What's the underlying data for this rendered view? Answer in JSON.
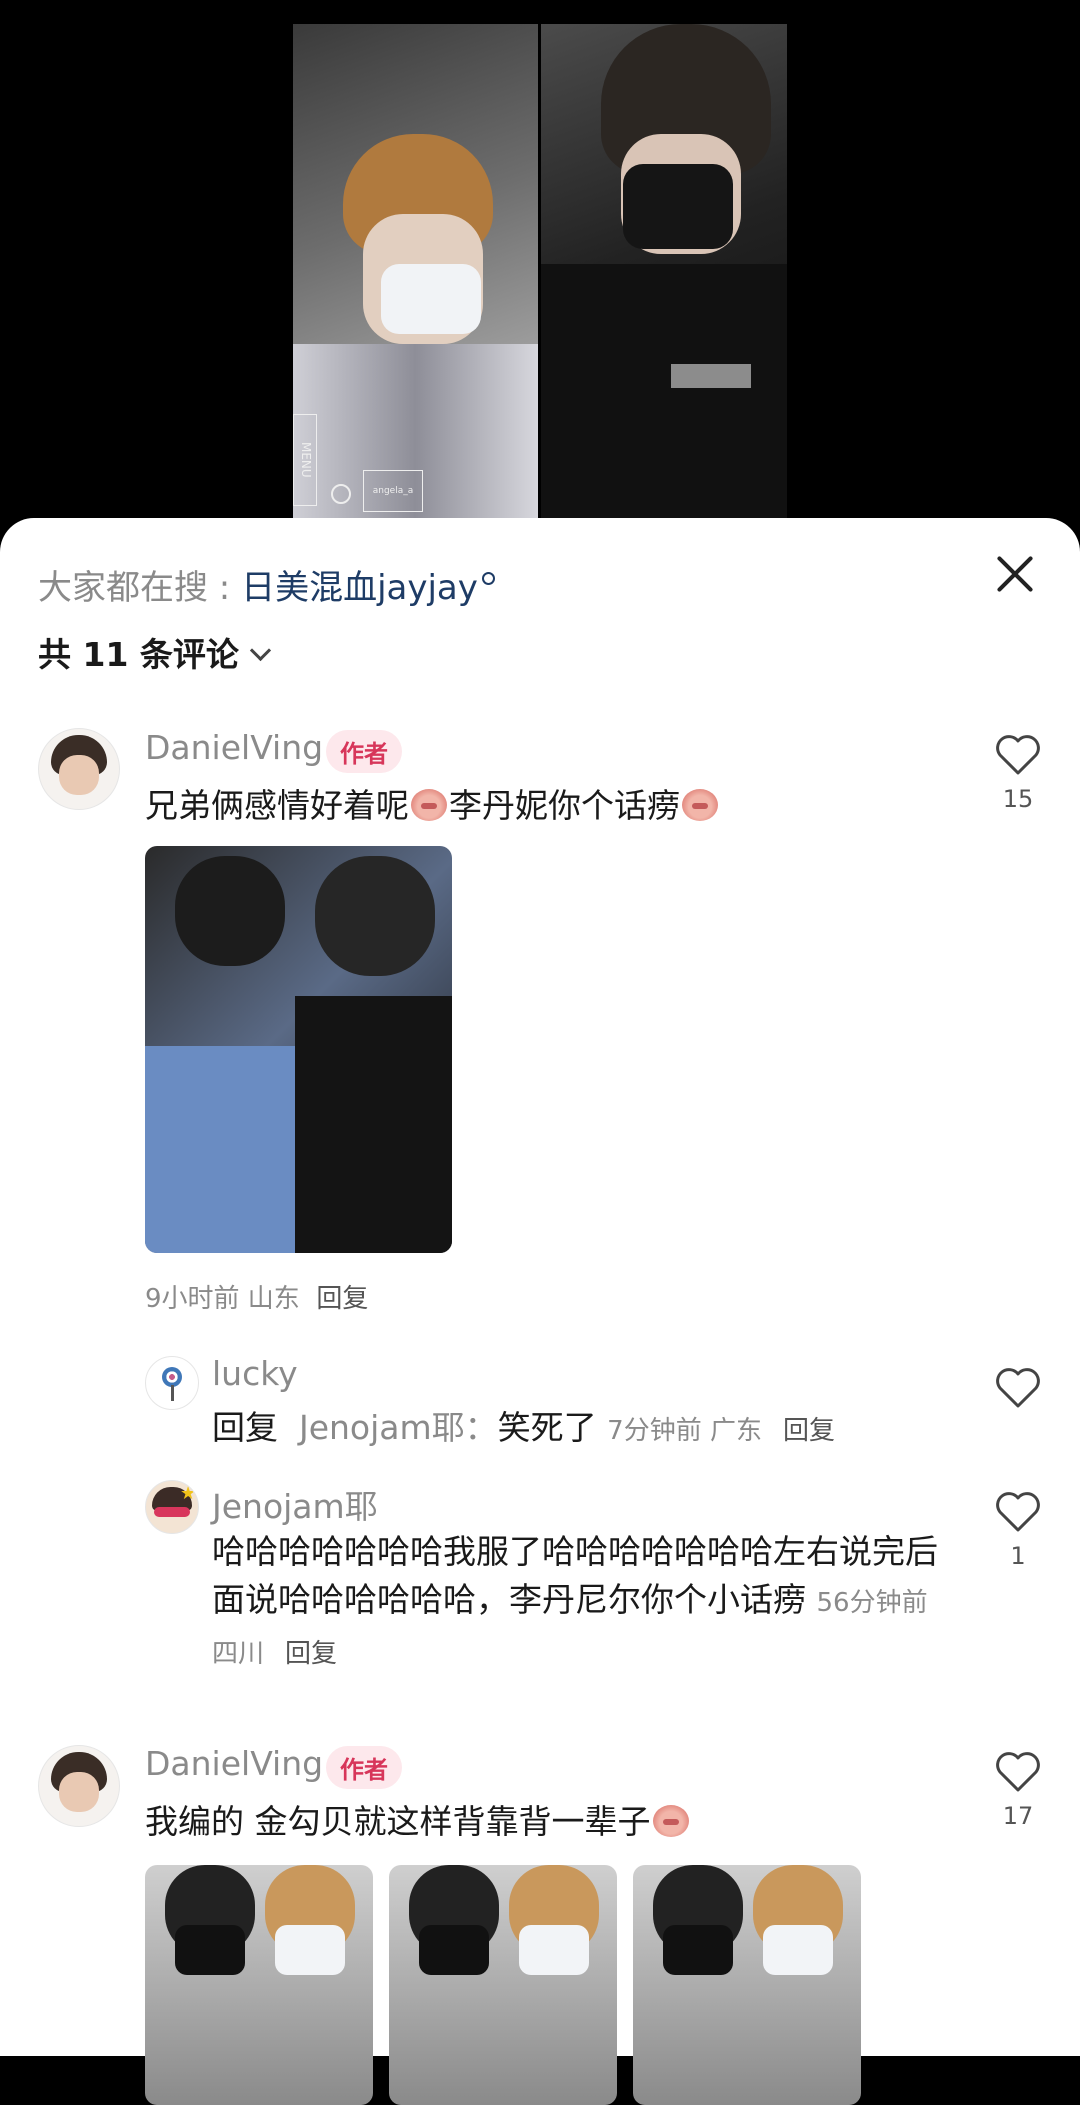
{
  "media": {
    "watermark_menu": "MENU",
    "watermark_text": "angela_a"
  },
  "search": {
    "prefix": "大家都在搜 : ",
    "term": "日美混血jayjay"
  },
  "comments_header": {
    "count_text": "共 11 条评论"
  },
  "comments": [
    {
      "author": "DanielVing",
      "badge": "作者",
      "text_part1": "兄弟俩感情好着呢",
      "text_part2": "李丹妮你个话痨",
      "meta_time": "9小时前 山东",
      "reply_label": "回复",
      "likes": "15"
    },
    {
      "author": "lucky",
      "reply_prefix": "回复",
      "reply_to": "Jenojam耶：",
      "text": "笑死了",
      "meta_time": "7分钟前 广东",
      "reply_label": "回复"
    },
    {
      "author": "Jenojam耶",
      "text": "哈哈哈哈哈哈哈我服了哈哈哈哈哈哈哈左右说完后面说哈哈哈哈哈哈，李丹尼尔你个小话痨",
      "meta_time": "56分钟前 四川",
      "reply_label": "回复",
      "likes": "1"
    },
    {
      "author": "DanielVing",
      "badge": "作者",
      "text_part1": "我编的 金勾贝就这样背靠背一辈子",
      "likes": "17"
    }
  ],
  "icons": {
    "close": "close-icon",
    "heart": "heart-outline-icon",
    "chevron": "chevron-down-icon",
    "search": "search-icon"
  },
  "colors": {
    "search_link": "#1e3c66",
    "author_badge_text": "#d7365a",
    "author_badge_bg": "#fde8ec"
  }
}
